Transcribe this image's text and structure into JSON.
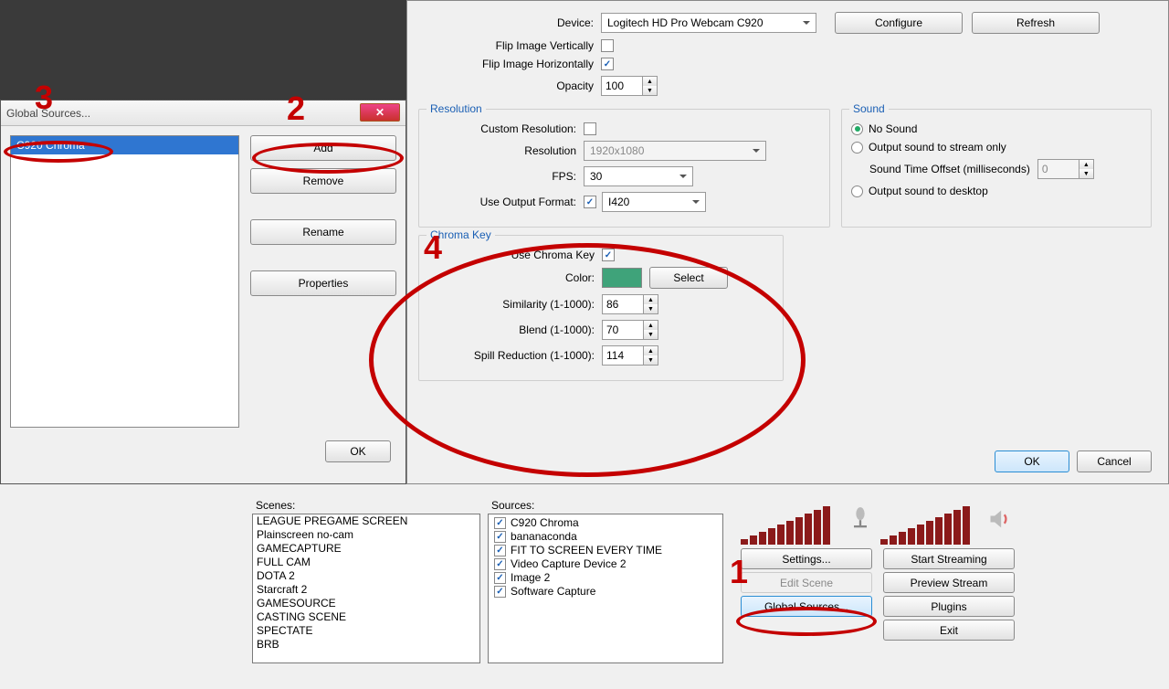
{
  "device": {
    "label": "Device:",
    "value": "Logitech HD Pro Webcam C920",
    "configure": "Configure",
    "refresh": "Refresh",
    "flip_v": "Flip Image Vertically",
    "flip_h": "Flip Image Horizontally",
    "opacity_label": "Opacity",
    "opacity_value": "100"
  },
  "resolution": {
    "title": "Resolution",
    "custom_label": "Custom Resolution:",
    "res_label": "Resolution",
    "res_value": "1920x1080",
    "fps_label": "FPS:",
    "fps_value": "30",
    "fmt_label": "Use Output Format:",
    "fmt_value": "I420"
  },
  "sound": {
    "title": "Sound",
    "none": "No Sound",
    "stream": "Output sound to stream only",
    "offset_label": "Sound Time Offset (milliseconds)",
    "offset_value": "0",
    "desktop": "Output sound to desktop"
  },
  "chroma": {
    "title": "Chroma Key",
    "use_label": "Use Chroma Key",
    "color_label": "Color:",
    "select": "Select",
    "color_value": "#3fa37a",
    "similarity_label": "Similarity (1-1000):",
    "similarity_value": "86",
    "blend_label": "Blend (1-1000):",
    "blend_value": "70",
    "spill_label": "Spill Reduction (1-1000):",
    "spill_value": "114"
  },
  "main_buttons": {
    "ok": "OK",
    "cancel": "Cancel"
  },
  "gs": {
    "title": "Global Sources...",
    "item": "C920 Chroma",
    "add": "Add",
    "remove": "Remove",
    "rename": "Rename",
    "properties": "Properties",
    "ok": "OK"
  },
  "bottom": {
    "scenes_label": "Scenes:",
    "scenes": [
      "LEAGUE PREGAME SCREEN",
      "Plainscreen no-cam",
      "GAMECAPTURE",
      "FULL CAM",
      "DOTA 2",
      "Starcraft 2",
      "GAMESOURCE",
      "CASTING SCENE",
      "SPECTATE",
      "BRB"
    ],
    "sources_label": "Sources:",
    "sources": [
      "C920 Chroma",
      "bananaconda",
      "FIT TO SCREEN EVERY TIME",
      "Video Capture Device 2",
      "Image 2",
      "Software Capture"
    ],
    "left_btns": {
      "settings": "Settings...",
      "edit": "Edit Scene",
      "global": "Global Sources..."
    },
    "right_btns": {
      "start": "Start Streaming",
      "preview": "Preview Stream",
      "plugins": "Plugins",
      "exit": "Exit"
    }
  },
  "annot": {
    "a1": "1",
    "a2": "2",
    "a3": "3",
    "a4": "4"
  }
}
